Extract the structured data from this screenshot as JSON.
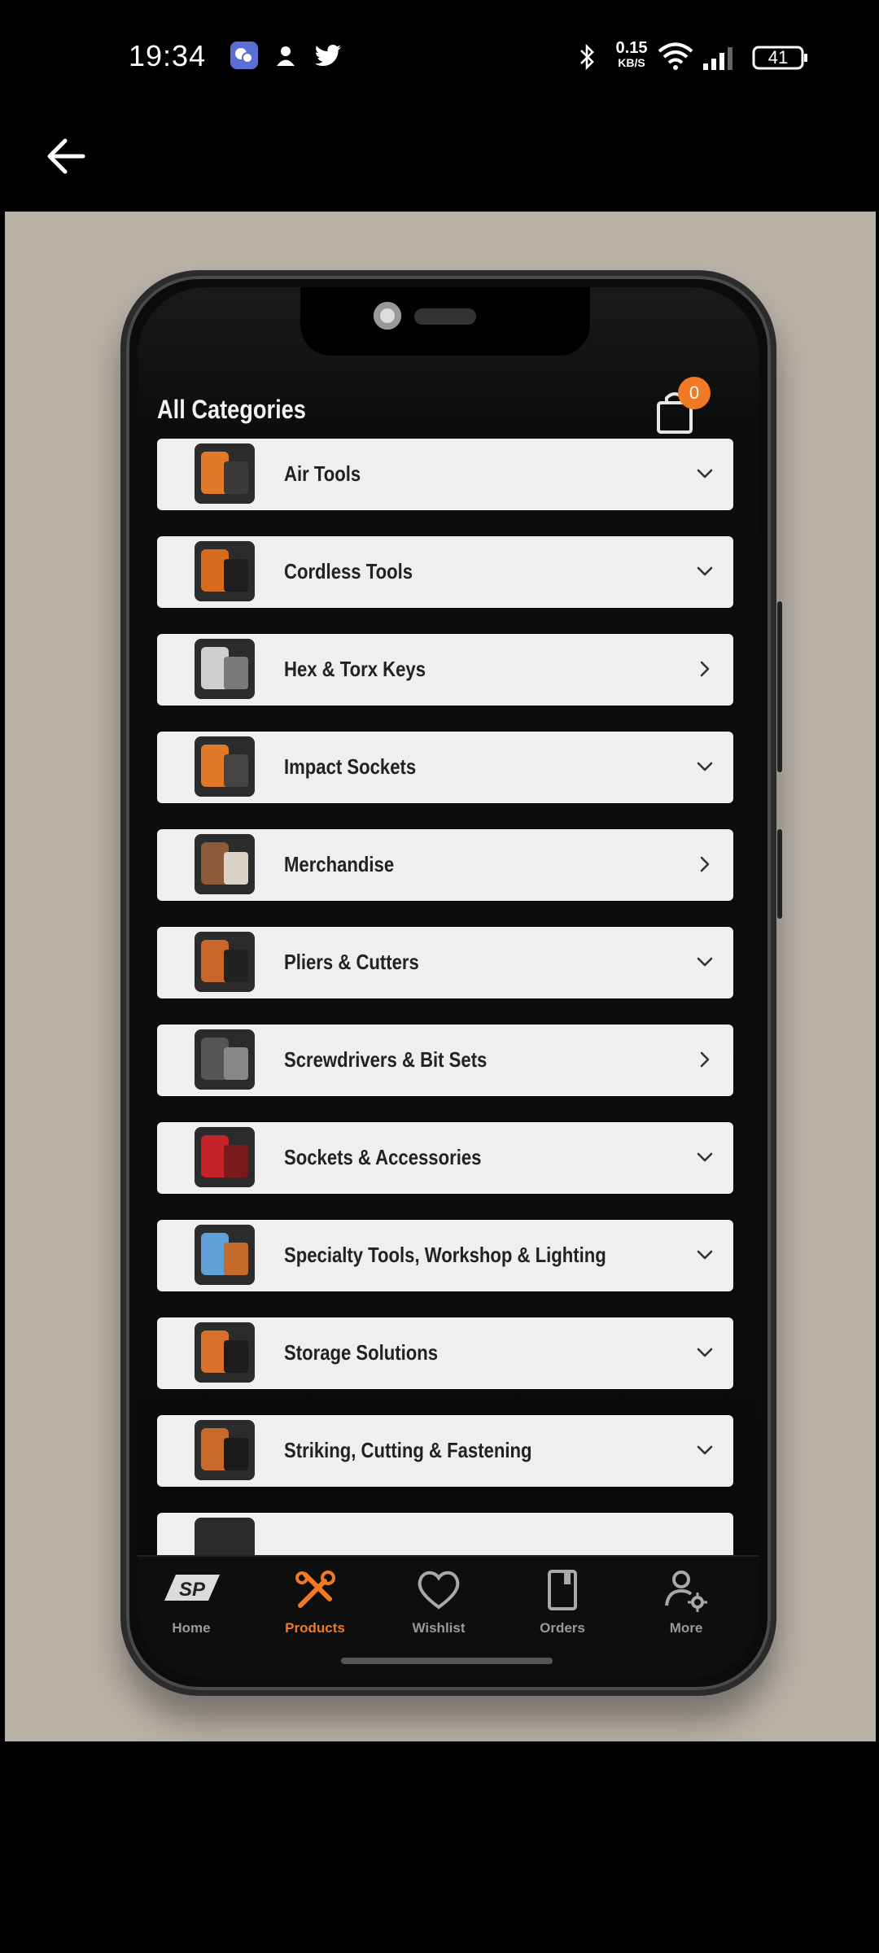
{
  "status_bar": {
    "time": "19:34",
    "speed_value": "0.15",
    "speed_unit": "KB/S",
    "battery": "41"
  },
  "app_screen": {
    "title": "All Categories",
    "cart_count": "0",
    "categories": [
      {
        "label": "Air Tools",
        "chevron": "chevron-down",
        "color_a": "#e07a2a",
        "color_b": "#3a3a3a"
      },
      {
        "label": "Cordless Tools",
        "chevron": "chevron-down",
        "color_a": "#d86b1f",
        "color_b": "#1e1e1e"
      },
      {
        "label": "Hex & Torx Keys",
        "chevron": "chevron-right",
        "color_a": "#cfcfcf",
        "color_b": "#7a7a7a"
      },
      {
        "label": "Impact Sockets",
        "chevron": "chevron-down",
        "color_a": "#e07a2a",
        "color_b": "#444444"
      },
      {
        "label": "Merchandise",
        "chevron": "chevron-right",
        "color_a": "#8a5a3a",
        "color_b": "#d9d2c5"
      },
      {
        "label": "Pliers & Cutters",
        "chevron": "chevron-down",
        "color_a": "#c9672a",
        "color_b": "#222222"
      },
      {
        "label": "Screwdrivers & Bit Sets",
        "chevron": "chevron-right",
        "color_a": "#555555",
        "color_b": "#888888"
      },
      {
        "label": "Sockets & Accessories",
        "chevron": "chevron-down",
        "color_a": "#c4232a",
        "color_b": "#7a1a1a"
      },
      {
        "label": "Specialty Tools, Workshop & Lighting",
        "chevron": "chevron-down",
        "color_a": "#5fa0d6",
        "color_b": "#c46a2a"
      },
      {
        "label": "Storage Solutions",
        "chevron": "chevron-down",
        "color_a": "#d6702a",
        "color_b": "#1c1c1c"
      },
      {
        "label": "Striking, Cutting & Fastening",
        "chevron": "chevron-down",
        "color_a": "#c96a2a",
        "color_b": "#1a1a1a"
      }
    ],
    "nav": [
      {
        "label": "Home",
        "icon": "sp-logo-icon",
        "active": false
      },
      {
        "label": "Products",
        "icon": "tools-icon",
        "active": true
      },
      {
        "label": "Wishlist",
        "icon": "heart-icon",
        "active": false
      },
      {
        "label": "Orders",
        "icon": "book-icon",
        "active": false
      },
      {
        "label": "More",
        "icon": "user-gear-icon",
        "active": false
      }
    ]
  },
  "colors": {
    "accent": "#f07a24",
    "photo_background": "#b8b1a6",
    "row_background": "#efefef"
  }
}
